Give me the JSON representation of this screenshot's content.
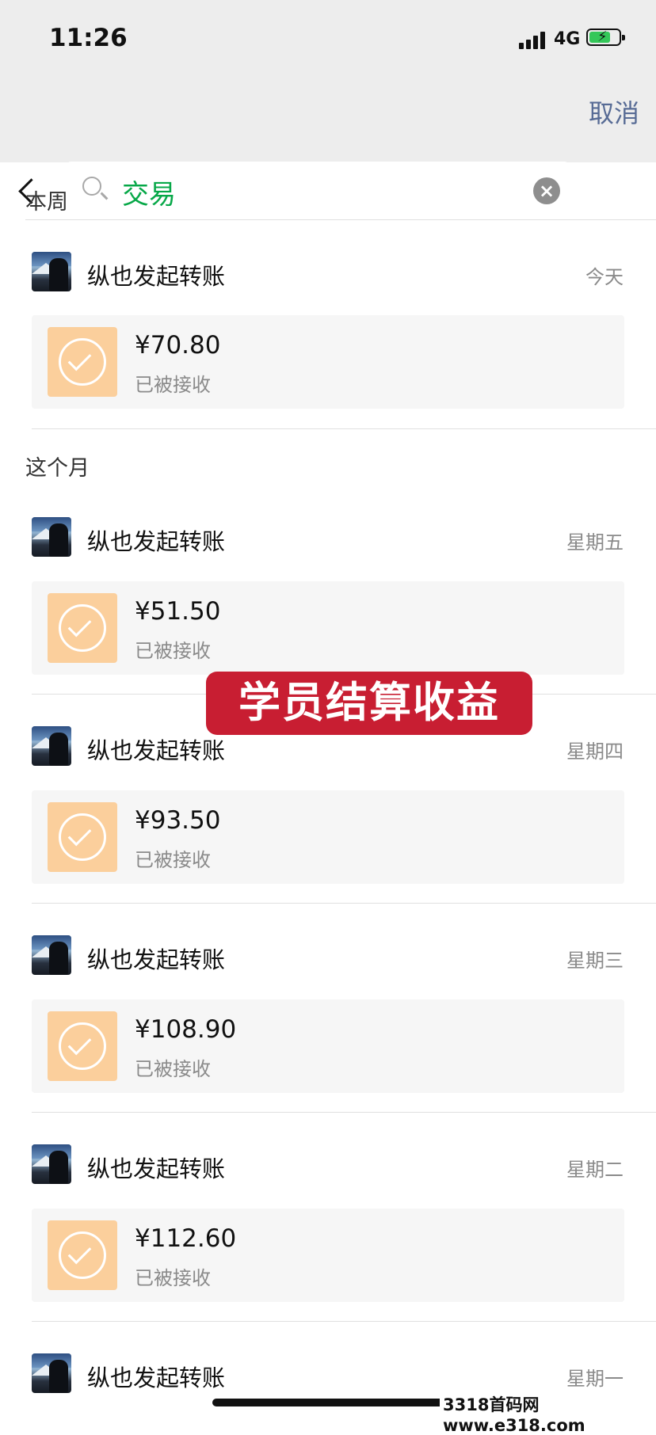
{
  "status_bar": {
    "time": "11:26",
    "network": "4G"
  },
  "search": {
    "query": "交易"
  },
  "cancel_label": "取消",
  "sections": {
    "this_week": "本周",
    "this_month": "这个月"
  },
  "items": [
    {
      "title": "纵也发起转账",
      "date": "今天",
      "amount": "¥70.80",
      "status": "已被接收"
    },
    {
      "title": "纵也发起转账",
      "date": "星期五",
      "amount": "¥51.50",
      "status": "已被接收"
    },
    {
      "title": "纵也发起转账",
      "date": "星期四",
      "amount": "¥93.50",
      "status": "已被接收"
    },
    {
      "title": "纵也发起转账",
      "date": "星期三",
      "amount": "¥108.90",
      "status": "已被接收"
    },
    {
      "title": "纵也发起转账",
      "date": "星期二",
      "amount": "¥112.60",
      "status": "已被接收"
    },
    {
      "title": "纵也发起转账",
      "date": "星期一"
    }
  ],
  "overlay_text": "学员结算收益",
  "watermark": "3318首码网www.e318.com",
  "colors": {
    "accent_green": "#07a848",
    "cancel_blue": "#576b95",
    "pay_orange": "#fbcf9c",
    "overlay_red": "#c81e32"
  }
}
